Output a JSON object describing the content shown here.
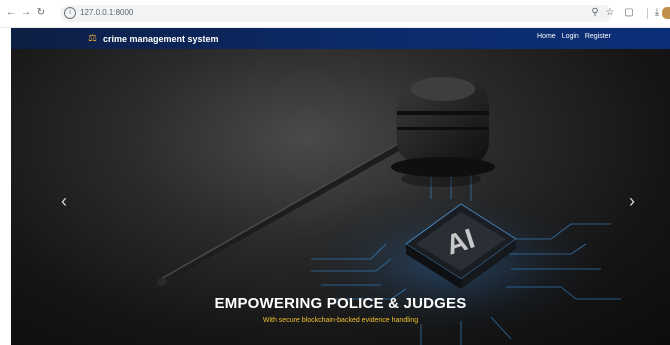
{
  "browser": {
    "url": "127.0.0.1:8000",
    "back_icon": "back-arrow-icon",
    "forward_icon": "forward-arrow-icon",
    "reload_icon": "reload-icon",
    "info_icon": "site-info-icon"
  },
  "navbar": {
    "brand": "crime management system",
    "brand_icon": "scales-icon",
    "links": [
      "Home",
      "Login",
      "Register"
    ]
  },
  "hero": {
    "title": "EMPOWERING POLICE & JUDGES",
    "subtitle": "With secure blockchain-backed evidence handling",
    "chip_label": "AI",
    "prev_icon": "chevron-left-icon",
    "next_icon": "chevron-right-icon"
  },
  "colors": {
    "navbar": "#0b2b6b",
    "subtitle": "#f0c02e",
    "circuit": "#3c8fd8"
  }
}
